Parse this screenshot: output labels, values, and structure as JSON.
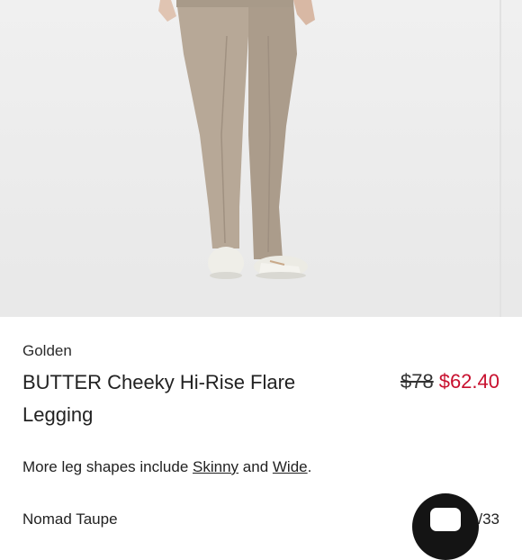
{
  "product": {
    "brand": "Golden",
    "title": "BUTTER Cheeky Hi-Rise Flare Legging",
    "price": {
      "original": "$78",
      "sale": "$62.40"
    },
    "leg_shapes": {
      "prefix": "More leg shapes include",
      "link1": "Skinny",
      "connector": "and",
      "link2": "Wide",
      "suffix": "."
    },
    "color": {
      "name": "Nomad Taupe",
      "count_fragment": "/33"
    }
  },
  "colors": {
    "sale": "#c8102e",
    "chat_button": "#141414",
    "fabric": "#b8a998"
  },
  "icons": {
    "chat": "chat-bubble-icon"
  }
}
